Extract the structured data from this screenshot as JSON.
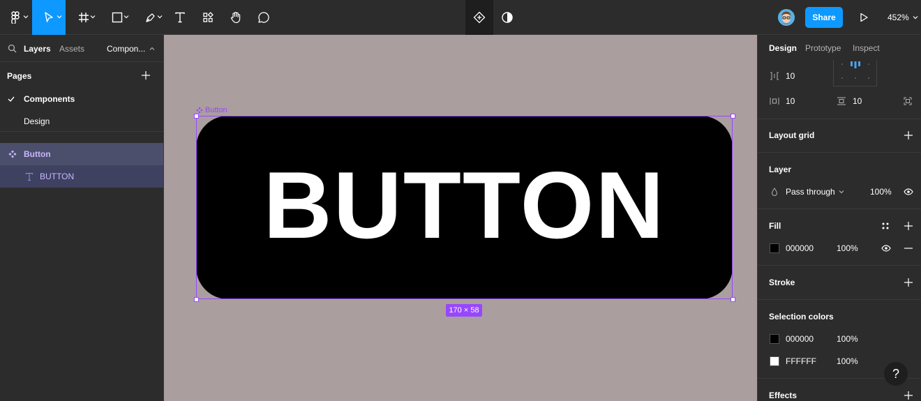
{
  "toolbar": {
    "zoom": "452%",
    "share_label": "Share"
  },
  "left_panel": {
    "tabs": [
      "Layers",
      "Assets",
      "Compon..."
    ],
    "pages_title": "Pages",
    "pages": [
      "Components",
      "Design"
    ],
    "layers": [
      {
        "label": "Button",
        "type": "component"
      },
      {
        "label": "BUTTON",
        "type": "text"
      }
    ]
  },
  "canvas": {
    "frame_label": "Button",
    "button_text": "BUTTON",
    "size_badge": "170 × 58",
    "background": "#ab9e9f"
  },
  "right_panel": {
    "tabs": [
      "Design",
      "Prototype",
      "Inspect"
    ],
    "spacing_between": "10",
    "padding_horizontal": "10",
    "padding_vertical": "10",
    "layout_grid_title": "Layout grid",
    "layer_title": "Layer",
    "blend_mode": "Pass through",
    "layer_opacity": "100%",
    "fill_title": "Fill",
    "fill_hex": "000000",
    "fill_opacity": "100%",
    "stroke_title": "Stroke",
    "selection_colors_title": "Selection colors",
    "selection_colors": [
      {
        "hex": "000000",
        "opacity": "100%",
        "color": "#000000"
      },
      {
        "hex": "FFFFFF",
        "opacity": "100%",
        "color": "#ffffff"
      }
    ],
    "effects_title": "Effects",
    "help_label": "?"
  },
  "colors": {
    "accent": "#0d99ff",
    "component": "#9747ff"
  }
}
